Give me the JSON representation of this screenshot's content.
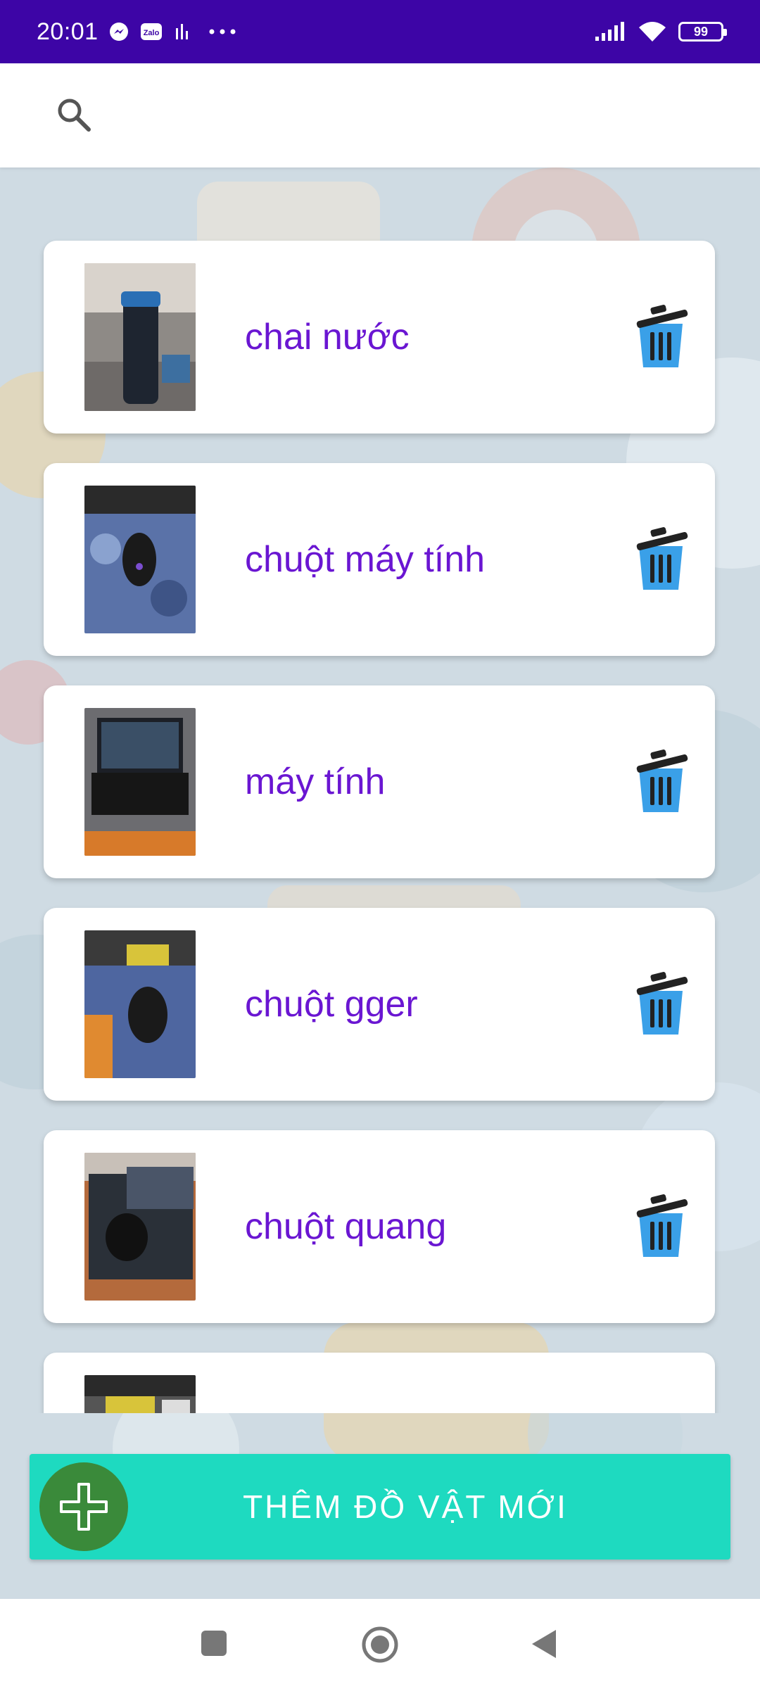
{
  "status_bar": {
    "time": "20:01",
    "battery": "99",
    "icons": [
      "messenger-icon",
      "zalo-icon",
      "activity-bars-icon",
      "more-dots-icon",
      "signal-icon",
      "wifi-icon",
      "battery-icon"
    ],
    "zalo_label": "Zalo"
  },
  "header": {
    "search_icon": "search-icon"
  },
  "items": [
    {
      "name": "chai nước",
      "thumb": "water-bottle-photo"
    },
    {
      "name": "chuột máy tính",
      "thumb": "computer-mouse-photo"
    },
    {
      "name": "máy tính",
      "thumb": "laptop-photo"
    },
    {
      "name": "chuột gger",
      "thumb": "gaming-mouse-photo"
    },
    {
      "name": "chuột quang",
      "thumb": "optical-mouse-photo"
    },
    {
      "name": "",
      "thumb": "desk-photo"
    }
  ],
  "add_button": {
    "label": "THÊM ĐỒ VẬT MỚI",
    "icon": "plus-icon"
  },
  "nav_bar": {
    "icons": [
      "recents-square-icon",
      "home-circle-icon",
      "back-triangle-icon"
    ]
  },
  "colors": {
    "status_bar": "#3d05a6",
    "item_text": "#6a16d2",
    "add_button": "#1edac0",
    "add_circle": "#3a8a3a",
    "trash": "#3aa0e8"
  }
}
